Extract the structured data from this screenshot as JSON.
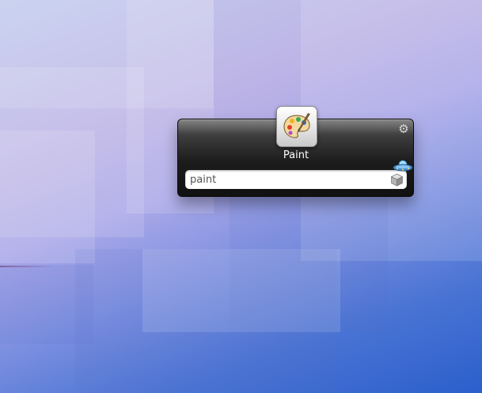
{
  "launcher": {
    "app_name": "Paint",
    "search": {
      "value": "paint",
      "placeholder": ""
    },
    "icons": {
      "app": "paint-palette-icon",
      "settings": "gear-icon",
      "plugin": "ufo-icon",
      "action": "cube-icon"
    }
  },
  "colors": {
    "panel_top": "#6a6a6a",
    "panel_bottom": "#111111",
    "text": "#ffffff",
    "desktop_light": "#c4cdee",
    "desktop_dark": "#2b5fcc"
  }
}
